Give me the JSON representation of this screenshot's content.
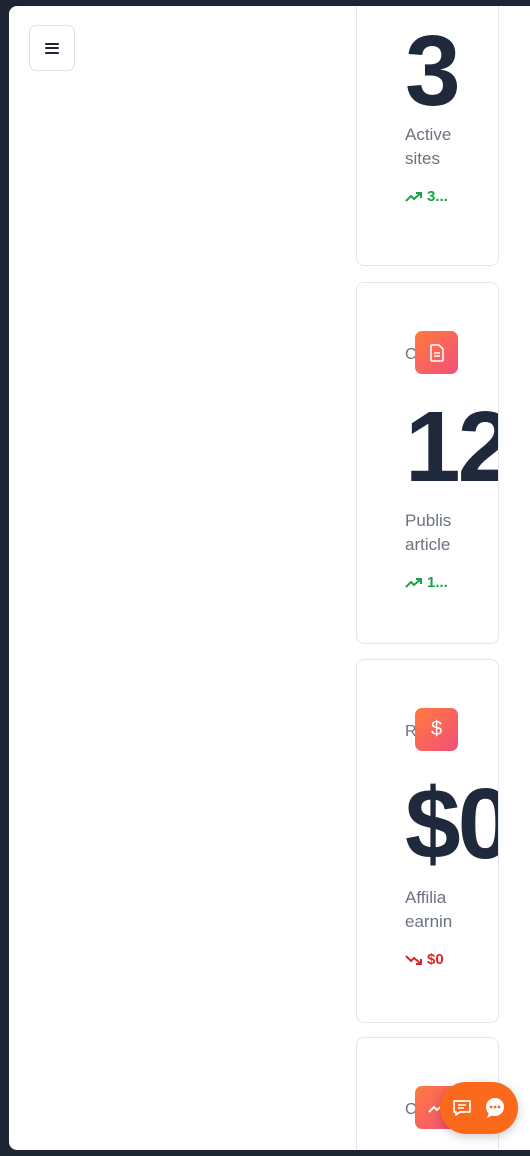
{
  "menu": {
    "icon": "hamburger-icon"
  },
  "cards": [
    {
      "value": "3",
      "desc_line1": "Active",
      "desc_line2": "sites",
      "trend": "3...",
      "trend_dir": "up"
    },
    {
      "label_initial": "C",
      "icon": "document-icon",
      "value": "12",
      "desc_line1": "Publis",
      "desc_line2": "article",
      "trend": "1...",
      "trend_dir": "up"
    },
    {
      "label_initial": "R",
      "icon": "dollar-icon",
      "value": "$0",
      "desc_line1": "Affilia",
      "desc_line2": "earnin",
      "trend": "$0",
      "trend_dir": "down"
    },
    {
      "label_initial": "C",
      "icon": "trending-up-icon"
    }
  ],
  "fab": {
    "icons": [
      "chat-icon",
      "message-bubble-icon"
    ]
  },
  "colors": {
    "accent": "#fb6a1c",
    "up": "#16a34a",
    "down": "#dc2626",
    "text_dark": "#1e293b"
  }
}
